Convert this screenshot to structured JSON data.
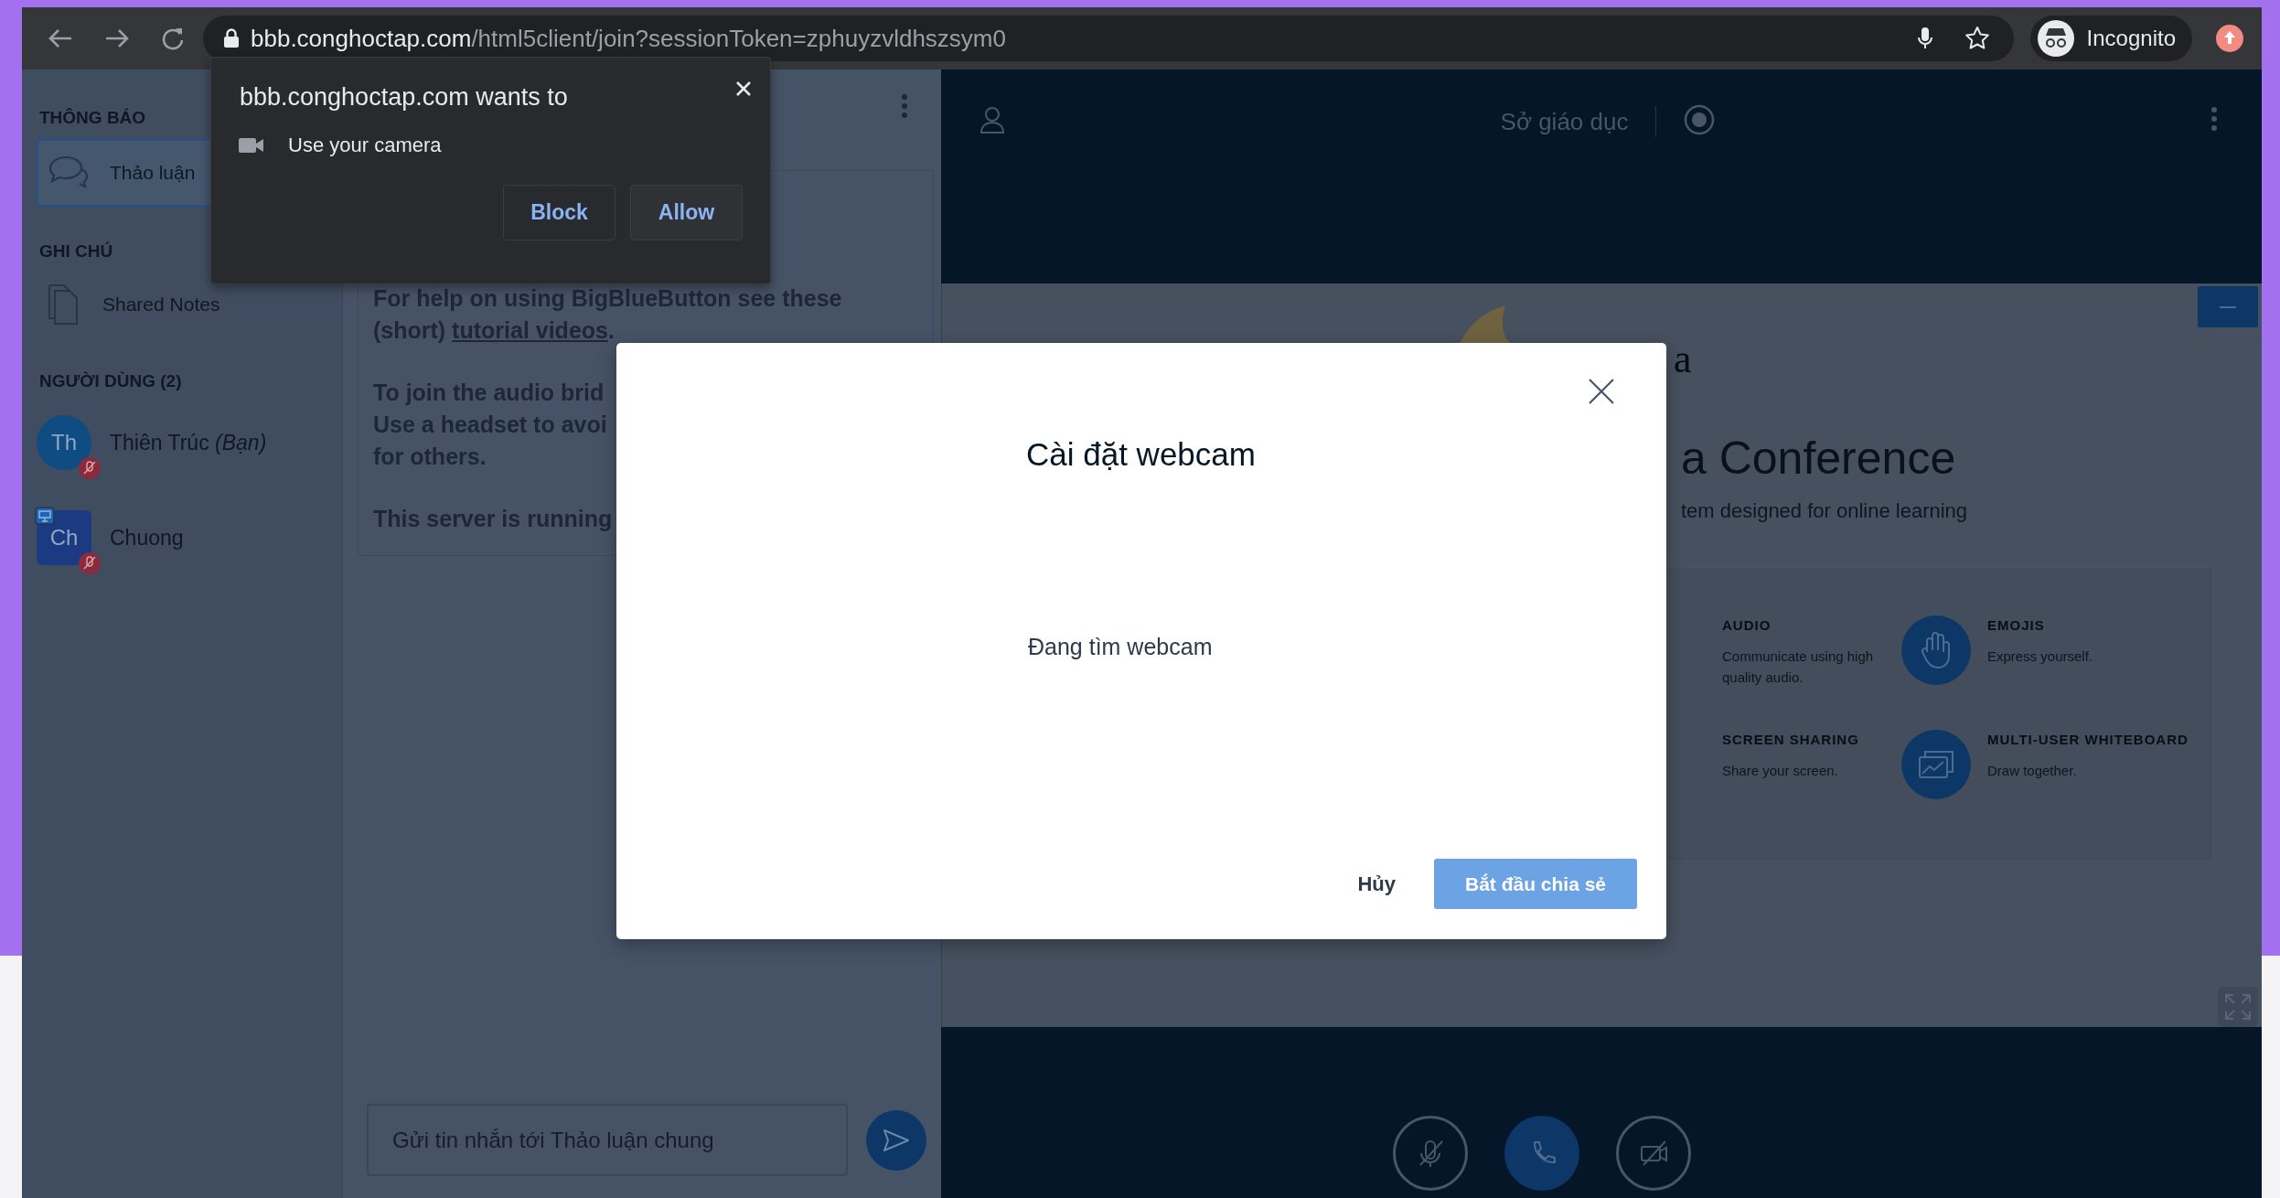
{
  "browser": {
    "url_host": "bbb.conghoctap.com",
    "url_path": "/html5client/join?sessionToken=zphuyzvldhszsym0",
    "profile": "Incognito"
  },
  "permission_prompt": {
    "title": "bbb.conghoctap.com wants to",
    "request": "Use your camera",
    "buttons": [
      "Block",
      "Allow"
    ]
  },
  "sidebar": {
    "sections": [
      {
        "title": "THÔNG BÁO",
        "items": [
          {
            "kind": "chat",
            "label": "Thảo luận",
            "selected": true
          }
        ]
      },
      {
        "title": "GHI CHÚ",
        "items": [
          {
            "kind": "notes",
            "label": "Shared Notes",
            "selected": false
          }
        ]
      },
      {
        "title": "NGƯỜI DÙNG (2)",
        "items": [
          {
            "kind": "user",
            "initials": "Th",
            "name": "Thiên Trúc",
            "suffix": "(Bạn)",
            "moderator": false,
            "presenter": false,
            "muted": true
          },
          {
            "kind": "user",
            "initials": "Ch",
            "name": "Chuong",
            "moderator": true,
            "presenter": true,
            "muted": true
          }
        ]
      }
    ]
  },
  "chat": {
    "welcome": [
      {
        "lines": [
          "For help on using BigBlueButton see these"
        ],
        "last": "(short) ",
        "link": "tutorial videos",
        "after": "."
      },
      {
        "lines": [
          "To join the audio brid",
          "Use a headset to avoi",
          "for others."
        ]
      },
      {
        "lines": [
          "This server is running"
        ]
      }
    ],
    "input": {
      "placeholder": "Gửi tin nhắn tới Thảo luận chung"
    }
  },
  "presentation": {
    "title": "Sở giáo dục",
    "slide": {
      "logo_text": "a",
      "heading": "a Conference",
      "subheading": "tem designed for online learning",
      "features": [
        {
          "kind": "audio",
          "title": "AUDIO",
          "text": "Communicate using high quality audio."
        },
        {
          "kind": "emojis",
          "title": "EMOJIS",
          "text": "Express yourself."
        },
        {
          "kind": "screen",
          "title": "SCREEN SHARING",
          "text": "Share your screen."
        },
        {
          "kind": "whiteboard",
          "title": "MULTI-USER WHITEBOARD",
          "text": "Draw together."
        }
      ]
    },
    "controls": [
      {
        "kind": "mic",
        "off": true
      },
      {
        "kind": "phone",
        "off": false
      },
      {
        "kind": "camera",
        "off": true
      }
    ]
  },
  "modal": {
    "title": "Cài đặt webcam",
    "status": "Đang tìm webcam",
    "cancel": "Hủy",
    "confirm": "Bắt đầu chia sẻ"
  }
}
